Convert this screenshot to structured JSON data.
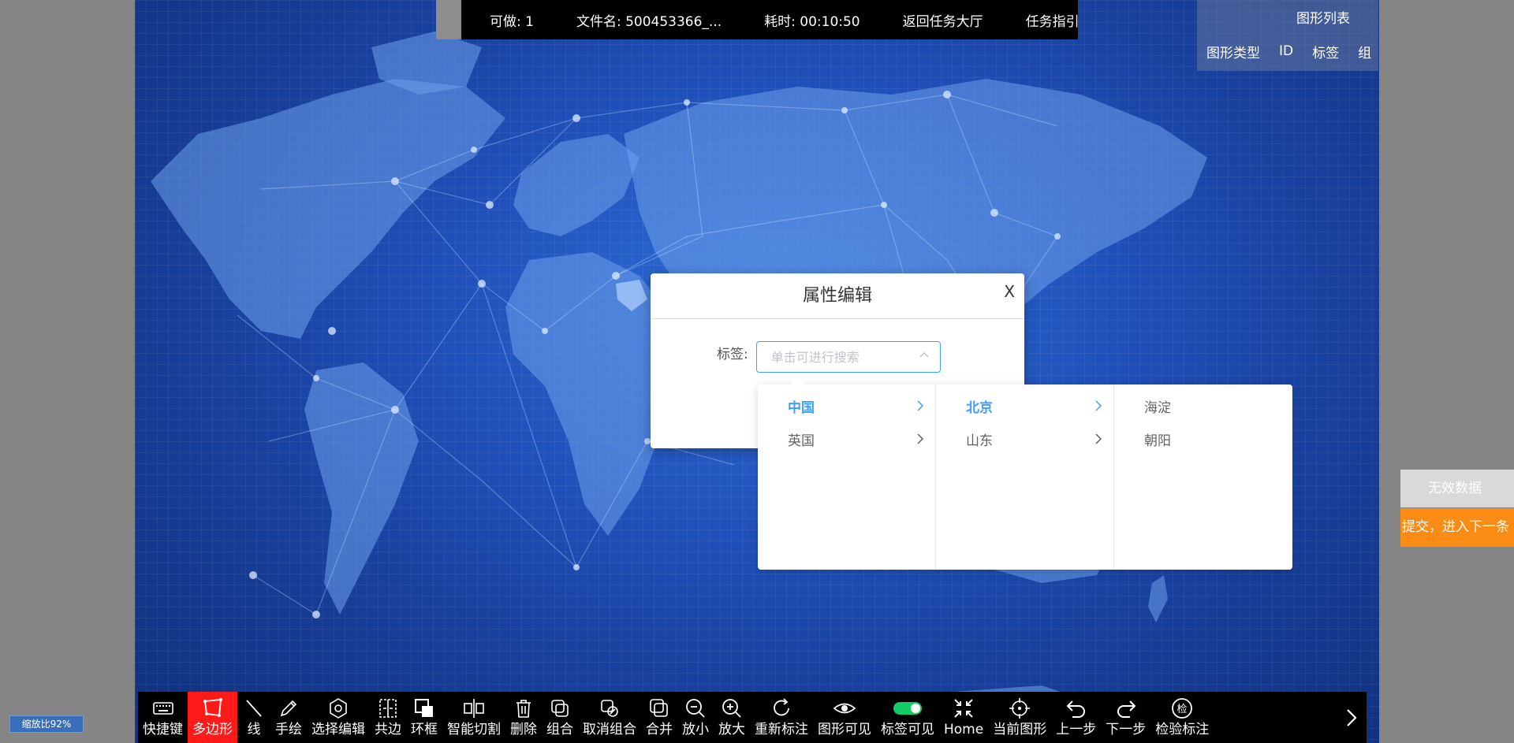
{
  "topbar": {
    "can_do": "可做: 1",
    "file_name": "文件名: 500453366_...",
    "elapsed": "耗时: 00:10:50",
    "back_to_hall": "返回任务大厅",
    "task_guide": "任务指引"
  },
  "shape_list": {
    "title": "图形列表",
    "columns": [
      "图形类型",
      "ID",
      "标签",
      "组"
    ]
  },
  "dialog": {
    "title": "属性编辑",
    "close": "X",
    "label_field": "标签:",
    "placeholder": "单击可进行搜索"
  },
  "cascader": {
    "accent": "#409eff",
    "col1": [
      {
        "label": "中国",
        "active": true
      },
      {
        "label": "英国",
        "active": false
      }
    ],
    "col2": [
      {
        "label": "北京",
        "active": true
      },
      {
        "label": "山东",
        "active": false
      }
    ],
    "col3": [
      {
        "label": "海淀"
      },
      {
        "label": "朝阳"
      }
    ]
  },
  "side_buttons": {
    "invalid": "无效数据",
    "submit": "提交，进入下一条"
  },
  "zoom_label": "缩放比92%",
  "toolbar": [
    {
      "label": "快捷键",
      "icon": "keyboard-icon",
      "active": false
    },
    {
      "label": "多边形",
      "icon": "polygon-icon",
      "active": true
    },
    {
      "label": "线",
      "icon": "line-icon",
      "active": false
    },
    {
      "label": "手绘",
      "icon": "pencil-icon",
      "active": false
    },
    {
      "label": "选择编辑",
      "icon": "hexagon-icon",
      "active": false
    },
    {
      "label": "共边",
      "icon": "shared-edge-icon",
      "active": false
    },
    {
      "label": "环框",
      "icon": "ring-frame-icon",
      "active": false
    },
    {
      "label": "智能切割",
      "icon": "smart-cut-icon",
      "active": false
    },
    {
      "label": "删除",
      "icon": "trash-icon",
      "active": false
    },
    {
      "label": "组合",
      "icon": "group-icon",
      "active": false
    },
    {
      "label": "取消组合",
      "icon": "ungroup-icon",
      "active": false
    },
    {
      "label": "合并",
      "icon": "merge-icon",
      "active": false
    },
    {
      "label": "放小",
      "icon": "zoom-out-icon",
      "active": false
    },
    {
      "label": "放大",
      "icon": "zoom-in-icon",
      "active": false
    },
    {
      "label": "重新标注",
      "icon": "redo-annotate-icon",
      "active": false
    },
    {
      "label": "图形可见",
      "icon": "eye-icon",
      "active": false
    },
    {
      "label": "标签可见",
      "icon": "toggle-icon",
      "active": true
    },
    {
      "label": "Home",
      "icon": "home-icon",
      "active": false
    },
    {
      "label": "当前图形",
      "icon": "crosshair-icon",
      "active": false
    },
    {
      "label": "上一步",
      "icon": "undo-icon",
      "active": false
    },
    {
      "label": "下一步",
      "icon": "redo-icon",
      "active": false
    },
    {
      "label": "检验标注",
      "icon": "check-icon",
      "active": false
    }
  ],
  "colors": {
    "submit": "#fa8c16",
    "active_tool": "#ff1a1a",
    "toggle_on": "#13ce66"
  }
}
